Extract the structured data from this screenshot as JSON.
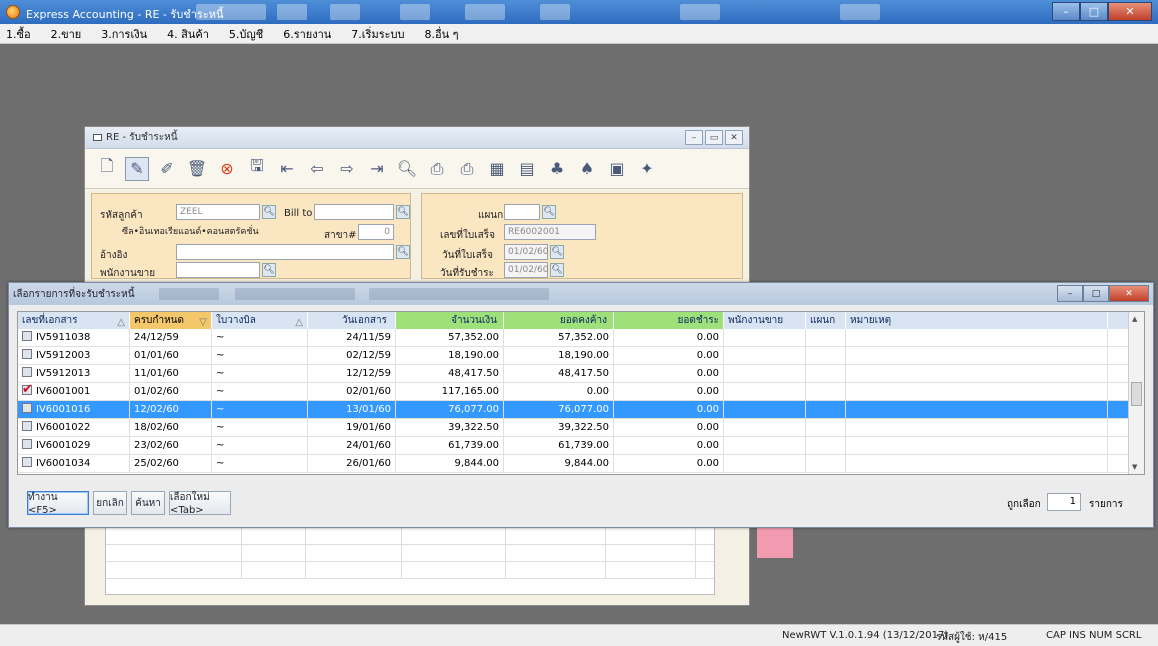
{
  "window": {
    "title": "Express Accounting - RE - รับชำระหนี้"
  },
  "menu": [
    "1.ซื้อ",
    "2.ขาย",
    "3.การเงิน",
    "4. สินค้า",
    "5.บัญชี",
    "6.รายงาน",
    "7.เริ่มระบบ",
    "8.อื่น ๆ"
  ],
  "child": {
    "title": "RE - รับชำระหนี้",
    "form": {
      "customer_code_label": "รหัสลูกค้า",
      "customer_code": "ZEEL",
      "bill_to_label": "Bill to",
      "customer_name": "ซีล•อินเทอเรียแอนด์•คอนสตรัคชั่น",
      "branch_label": "สาขา#",
      "branch_value": "0",
      "reference_label": "อ้างอิง",
      "salesperson_label": "พนักงานขาย",
      "department_label": "แผนก",
      "receipt_no_label": "เลขที่ใบเสร็จ",
      "receipt_no": "RE6002001",
      "receipt_date_label": "วันที่ใบเสร็จ",
      "receipt_date": "01/02/60",
      "payment_date_label": "วันที่รับชำระ",
      "payment_date": "01/02/60"
    }
  },
  "popup": {
    "title": "เลือกรายการที่จะรับชำระหนี้",
    "columns": [
      "เลขที่เอกสาร",
      "ครบกำหนด",
      "ใบวางบิล",
      "วันเอกสาร",
      "จำนวนเงิน",
      "ยอดคงค้าง",
      "ยอดชำระ",
      "พนักงานขาย",
      "แผนก",
      "หมายเหตุ"
    ],
    "rows": [
      {
        "doc": "IV5911038",
        "due": "24/12/59",
        "bill": "~",
        "date": "24/11/59",
        "amount": "57,352.00",
        "outstanding": "57,352.00",
        "paid": "0.00",
        "checked": false
      },
      {
        "doc": "IV5912003",
        "due": "01/01/60",
        "bill": "~",
        "date": "02/12/59",
        "amount": "18,190.00",
        "outstanding": "18,190.00",
        "paid": "0.00",
        "checked": false
      },
      {
        "doc": "IV5912013",
        "due": "11/01/60",
        "bill": "~",
        "date": "12/12/59",
        "amount": "48,417.50",
        "outstanding": "48,417.50",
        "paid": "0.00",
        "checked": false
      },
      {
        "doc": "IV6001001",
        "due": "01/02/60",
        "bill": "~",
        "date": "02/01/60",
        "amount": "117,165.00",
        "outstanding": "0.00",
        "paid": "0.00",
        "checked": true
      },
      {
        "doc": "IV6001016",
        "due": "12/02/60",
        "bill": "~",
        "date": "13/01/60",
        "amount": "76,077.00",
        "outstanding": "76,077.00",
        "paid": "0.00",
        "checked": false,
        "selected": true
      },
      {
        "doc": "IV6001022",
        "due": "18/02/60",
        "bill": "~",
        "date": "19/01/60",
        "amount": "39,322.50",
        "outstanding": "39,322.50",
        "paid": "0.00",
        "checked": false
      },
      {
        "doc": "IV6001029",
        "due": "23/02/60",
        "bill": "~",
        "date": "24/01/60",
        "amount": "61,739.00",
        "outstanding": "61,739.00",
        "paid": "0.00",
        "checked": false
      },
      {
        "doc": "IV6001034",
        "due": "25/02/60",
        "bill": "~",
        "date": "26/01/60",
        "amount": "9,844.00",
        "outstanding": "9,844.00",
        "paid": "0.00",
        "checked": false
      }
    ],
    "buttons": {
      "ok": "ทำงาน <F5>",
      "cancel": "ยกเลิก",
      "search": "ค้นหา",
      "reselect": "เลือกใหม่ <Tab>"
    },
    "selected_label": "ถูกเลือก",
    "selected_count": "1",
    "items_label": "รายการ"
  },
  "status": {
    "version": "NewRWT V.1.0.1.94 (13/12/2017)",
    "user": "รหัสผู้ใช้: ห/415",
    "keys": "CAP  INS   NUM  SCRL"
  },
  "colors": {
    "selection": "#3399ff",
    "header_green": "#9ee07a",
    "form_bg": "#fbe6c2",
    "accent_pink": "#f29ab0"
  }
}
